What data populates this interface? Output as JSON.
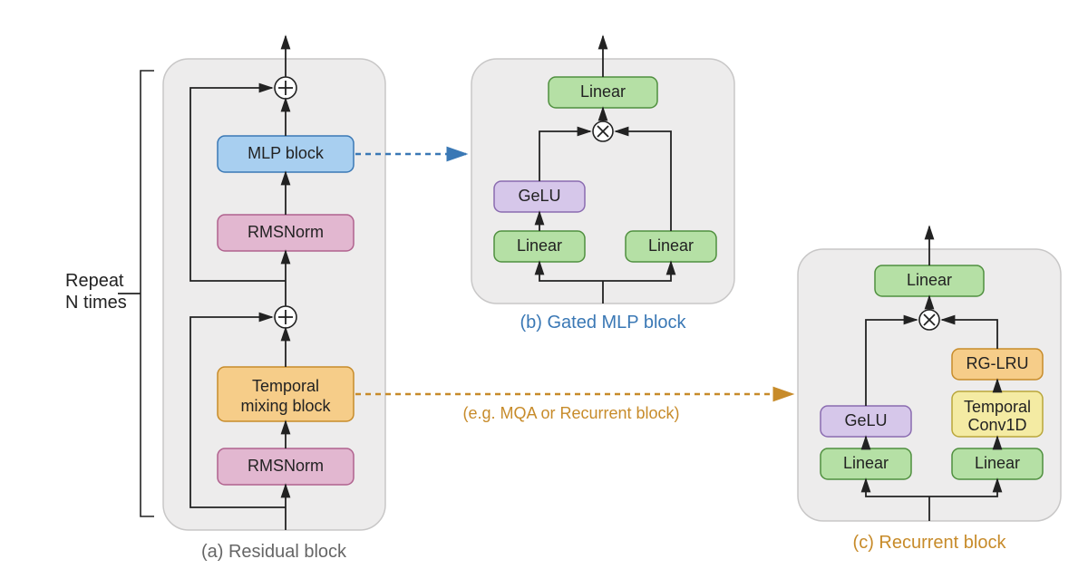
{
  "side_label": {
    "line1": "Repeat",
    "line2": "N times"
  },
  "captions": {
    "a": "(a) Residual block",
    "b": "(b) Gated MLP block",
    "c": "(c) Recurrent block"
  },
  "mqa_note": "(e.g. MQA or Recurrent block)",
  "blocks": {
    "mlp": "MLP block",
    "rmsnorm": "RMSNorm",
    "temporal_mix_l1": "Temporal",
    "temporal_mix_l2": "mixing block",
    "linear": "Linear",
    "gelu": "GeLU",
    "rg_lru": "RG-LRU",
    "tconv_l1": "Temporal",
    "tconv_l2": "Conv1D"
  }
}
